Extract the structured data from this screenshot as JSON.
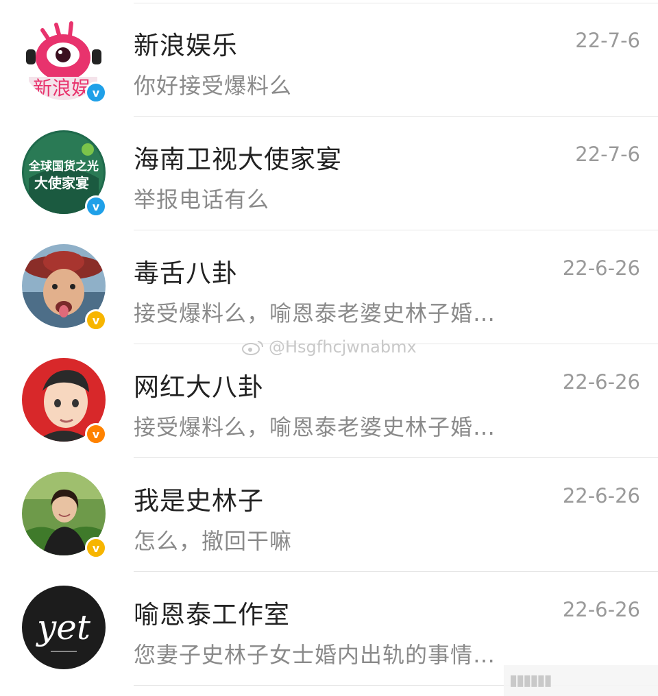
{
  "conversations": [
    {
      "name": "新浪娱乐",
      "message": "你好接受爆料么",
      "date": "22-7-6",
      "badge": "blue",
      "avatar_icon": "sina-ent-logo-icon"
    },
    {
      "name": "海南卫视大使家宴",
      "message": "举报电话有么",
      "date": "22-7-6",
      "badge": "blue",
      "avatar_icon": "ambassador-banquet-logo-icon",
      "avatar_text": "全球国货之光\n大使家宴"
    },
    {
      "name": "毒舌八卦",
      "message": "接受爆料么，喻恩泰老婆史林子婚…",
      "date": "22-6-26",
      "badge": "gold",
      "avatar_icon": "man-with-hat-photo-icon"
    },
    {
      "name": "网红大八卦",
      "message": "接受爆料么，喻恩泰老婆史林子婚…",
      "date": "22-6-26",
      "badge": "orange",
      "avatar_icon": "cartoon-boy-avatar-icon"
    },
    {
      "name": "我是史林子",
      "message": "怎么，撤回干嘛",
      "date": "22-6-26",
      "badge": "gold",
      "avatar_icon": "woman-photo-icon"
    },
    {
      "name": "喻恩泰工作室",
      "message": "您妻子史林子女士婚内出轨的事情…",
      "date": "22-6-26",
      "badge": "none",
      "avatar_icon": "yet-logo-icon",
      "avatar_text": "yet"
    }
  ],
  "badge_glyph": "v",
  "watermark": {
    "text": "@Hsgfhcjwnabmx",
    "icon": "weibo-icon"
  },
  "colors": {
    "verified_blue": "#1fa0e8",
    "verified_gold": "#f7b500",
    "verified_orange": "#ff8200"
  }
}
